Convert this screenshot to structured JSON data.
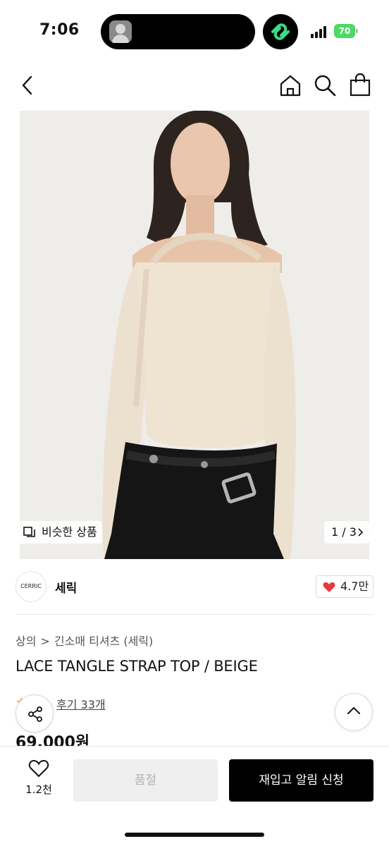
{
  "status_bar": {
    "time": "7:06",
    "battery": "70",
    "battery_color": "#4cd964",
    "chat_badge_color": "#3ddc84"
  },
  "nav": {
    "back_icon": "chevron-left-icon",
    "home_icon": "home-icon",
    "search_icon": "search-icon",
    "cart_icon": "shopping-bag-icon"
  },
  "image": {
    "similar_label": "비슷한 상품",
    "pager": "1 / 3"
  },
  "brand": {
    "logo_text": "CERRIC",
    "name": "세릭",
    "likes": "4.7만",
    "heart_color": "#e8383d"
  },
  "product": {
    "breadcrumb": [
      "상의",
      "긴소매 티셔츠 (세릭)"
    ],
    "title": "LACE TANGLE STRAP TOP / BEIGE",
    "stars": "★★★",
    "review_link": "후기 33개",
    "price": "69,000원"
  },
  "bottom_bar": {
    "wish_count": "1.2천",
    "soldout_label": "품절",
    "restock_label": "재입고 알림 신청"
  }
}
